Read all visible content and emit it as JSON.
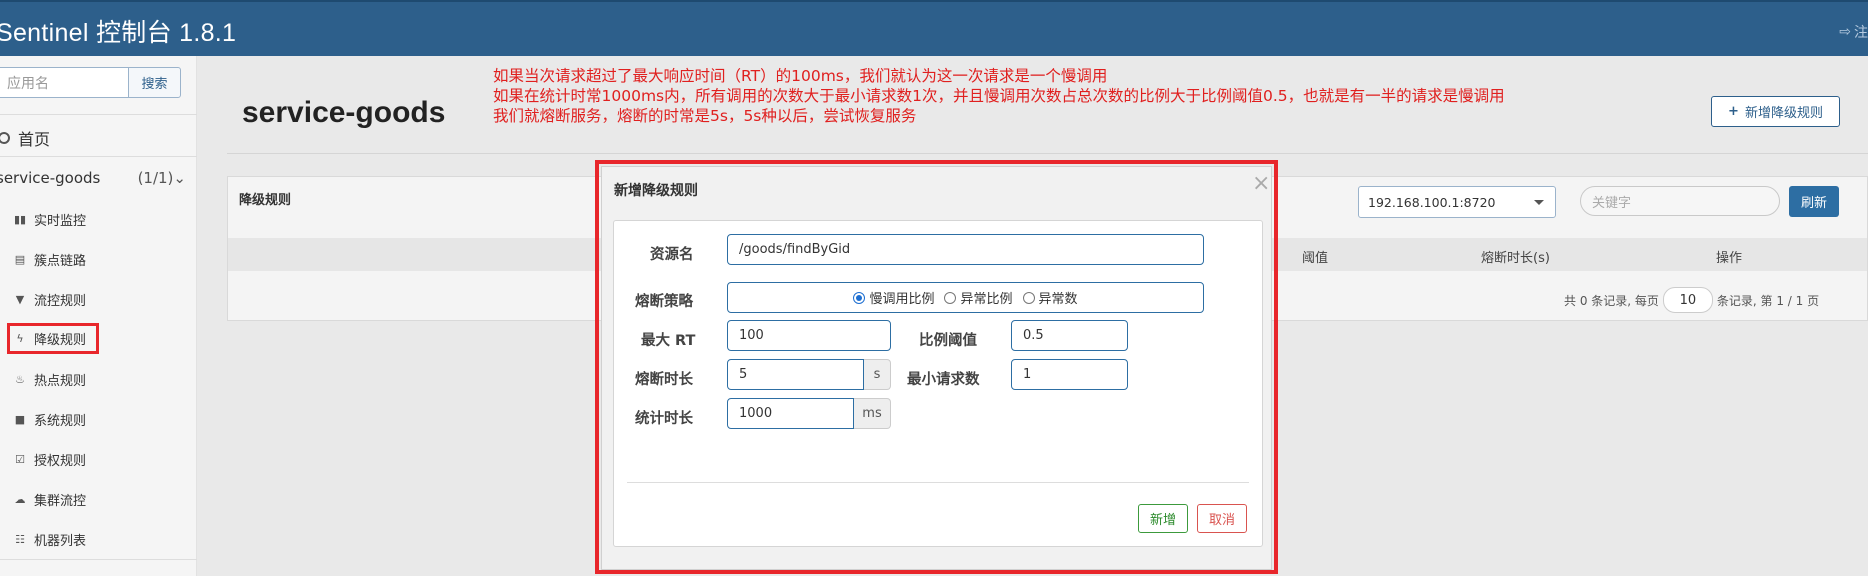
{
  "header": {
    "title": "Sentinel 控制台 1.8.1",
    "logout_label": "注"
  },
  "sidebar": {
    "search_placeholder": "应用名",
    "search_button": "搜索",
    "home_label": "首页",
    "app_name": "service-goods",
    "app_count": "(1/1)",
    "items": [
      {
        "label": "实时监控",
        "icon": "bar-chart-icon"
      },
      {
        "label": "簇点链路",
        "icon": "list-icon"
      },
      {
        "label": "流控规则",
        "icon": "filter-icon"
      },
      {
        "label": "降级规则",
        "icon": "flash-icon"
      },
      {
        "label": "热点规则",
        "icon": "fire-icon"
      },
      {
        "label": "系统规则",
        "icon": "lock-icon"
      },
      {
        "label": "授权规则",
        "icon": "check-icon"
      },
      {
        "label": "集群流控",
        "icon": "cloud-icon"
      },
      {
        "label": "机器列表",
        "icon": "th-list-icon"
      }
    ]
  },
  "main": {
    "page_title": "service-goods",
    "add_rule_label": "新增降级规则",
    "annotation_lines": [
      "如果当次请求超过了最大响应时间（RT）的100ms，我们就认为这一次请求是一个慢调用",
      "如果在统计时常1000ms内，所有调用的次数大于最小请求数1次，并且慢调用次数占总次数的比例大于比例阈值0.5，也就是有一半的请求是慢调用",
      "我们就熔断服务，熔断的时常是5s，5s种以后，尝试恢复服务"
    ],
    "panel": {
      "title": "降级规则",
      "machine_select": "192.168.100.1:8720",
      "keyword_placeholder": "关键字",
      "refresh_label": "刷新",
      "columns": [
        "阈值",
        "熔断时长(s)",
        "操作"
      ],
      "pager_prefix": "共 0 条记录, 每页",
      "page_size": "10",
      "pager_suffix": "条记录, 第 1 / 1 页"
    }
  },
  "modal": {
    "title": "新增降级规则",
    "close": "×",
    "resource_label": "资源名",
    "resource_value": "/goods/findByGid",
    "strategy_label": "熔断策略",
    "strategy_options": [
      "慢调用比例",
      "异常比例",
      "异常数"
    ],
    "strategy_selected": 0,
    "max_rt_label": "最大 RT",
    "max_rt_value": "100",
    "ratio_label": "比例阈值",
    "ratio_value": "0.5",
    "duration_label": "熔断时长",
    "duration_value": "5",
    "duration_unit": "s",
    "min_request_label": "最小请求数",
    "min_request_value": "1",
    "stat_label": "统计时长",
    "stat_value": "1000",
    "stat_unit": "ms",
    "add_label": "新增",
    "cancel_label": "取消"
  },
  "colors": {
    "header_bg": "#2d5f8b",
    "highlight_red": "#e8262b",
    "annotation_text": "#e0201f"
  }
}
